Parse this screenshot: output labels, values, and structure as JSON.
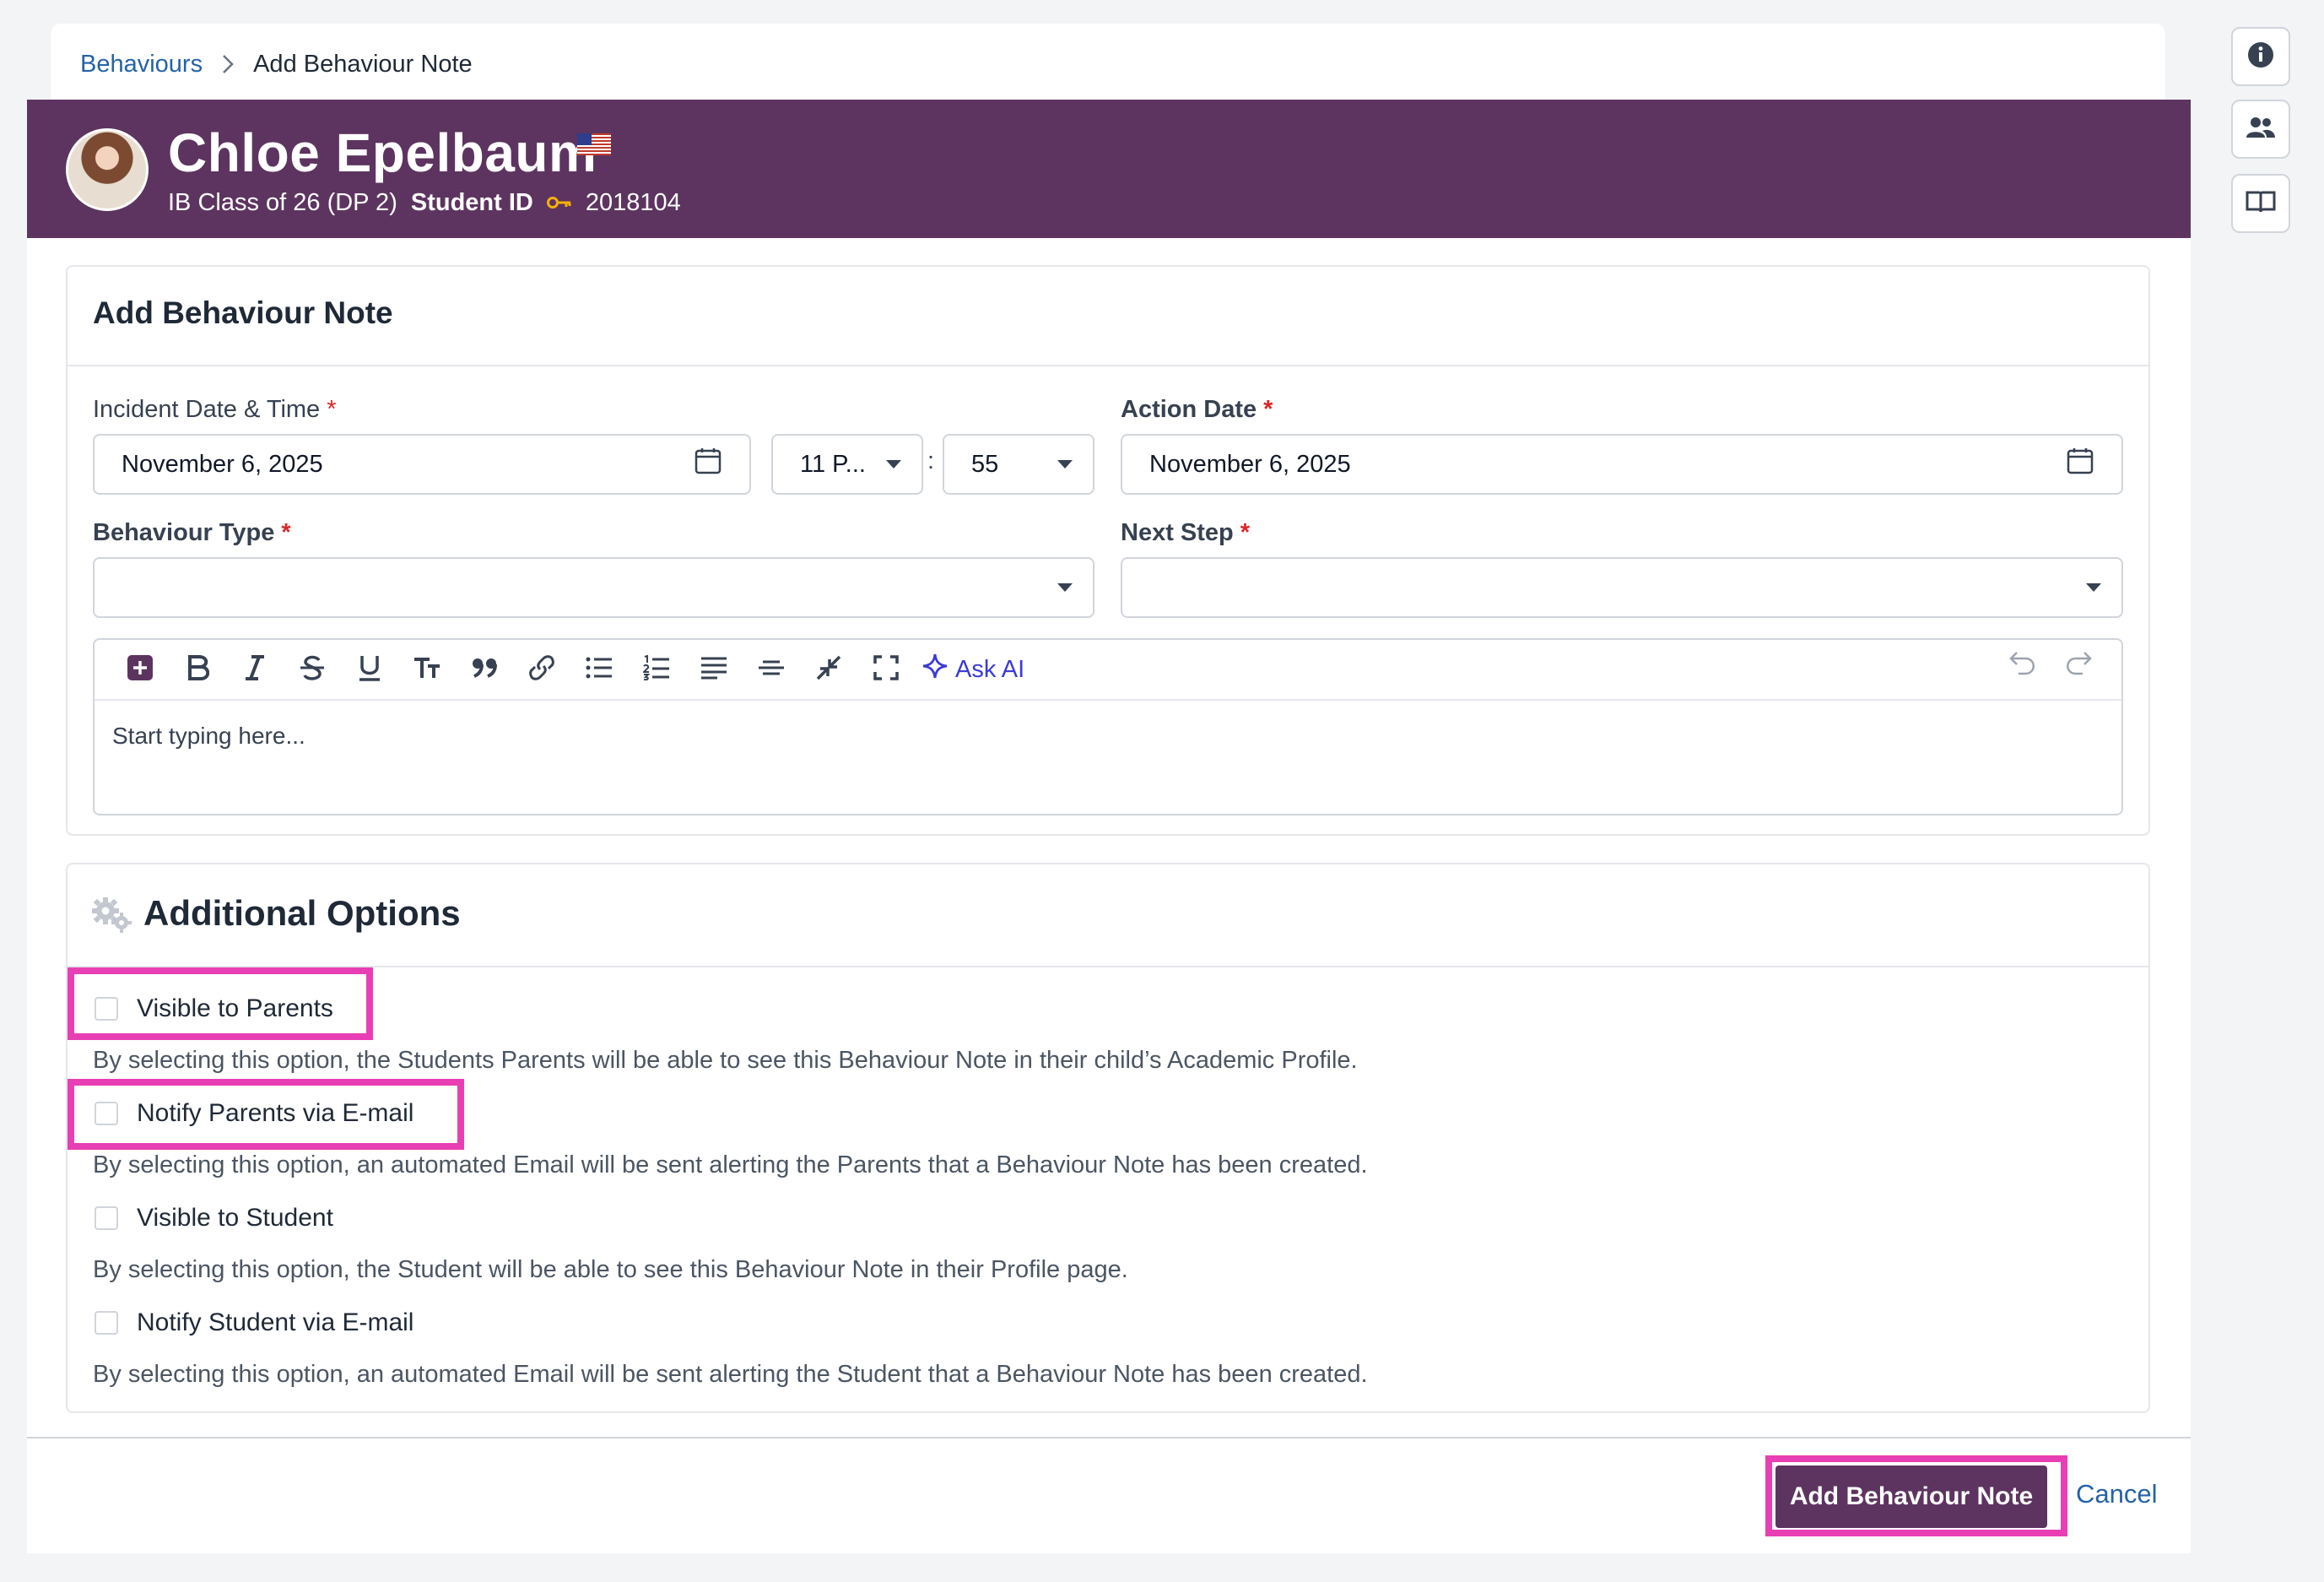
{
  "breadcrumb": {
    "root": "Behaviours",
    "current": "Add Behaviour Note"
  },
  "student": {
    "name": "Chloe Epelbaum",
    "class": "IB Class of 26 (DP 2)",
    "id_label": "Student ID",
    "id_value": "2018104"
  },
  "form": {
    "title": "Add Behaviour Note",
    "incident_label": "Incident Date & Time",
    "incident_date": "November 6, 2025",
    "hour": "11 P...",
    "time_sep": ":",
    "minute": "55",
    "action_label": "Action Date",
    "action_date": "November 6, 2025",
    "type_label": "Behaviour Type",
    "type_value": "",
    "next_label": "Next Step",
    "next_value": "",
    "required_mark": "*"
  },
  "editor": {
    "placeholder": "Start typing here...",
    "ask_ai": "Ask AI"
  },
  "options": {
    "title": "Additional Options",
    "items": [
      {
        "label": "Visible to Parents",
        "help": "By selecting this option, the Students Parents will be able to see this Behaviour Note in their child’s Academic Profile."
      },
      {
        "label": "Notify Parents via E-mail",
        "help": "By selecting this option, an automated Email will be sent alerting the Parents that a Behaviour Note has been created."
      },
      {
        "label": "Visible to Student",
        "help": "By selecting this option, the Student will be able to see this Behaviour Note in their Profile page."
      },
      {
        "label": "Notify Student via E-mail",
        "help": "By selecting this option, an automated Email will be sent alerting the Student that a Behaviour Note has been created."
      }
    ]
  },
  "footer": {
    "submit": "Add Behaviour Note",
    "cancel": "Cancel"
  },
  "colors": {
    "brand_purple": "#5d3460",
    "link_blue": "#2563a6",
    "highlight_pink": "#e83fb4",
    "required_red": "#dc2626"
  },
  "icons": {
    "side_buttons": [
      "info-icon",
      "people-icon",
      "book-icon"
    ]
  }
}
